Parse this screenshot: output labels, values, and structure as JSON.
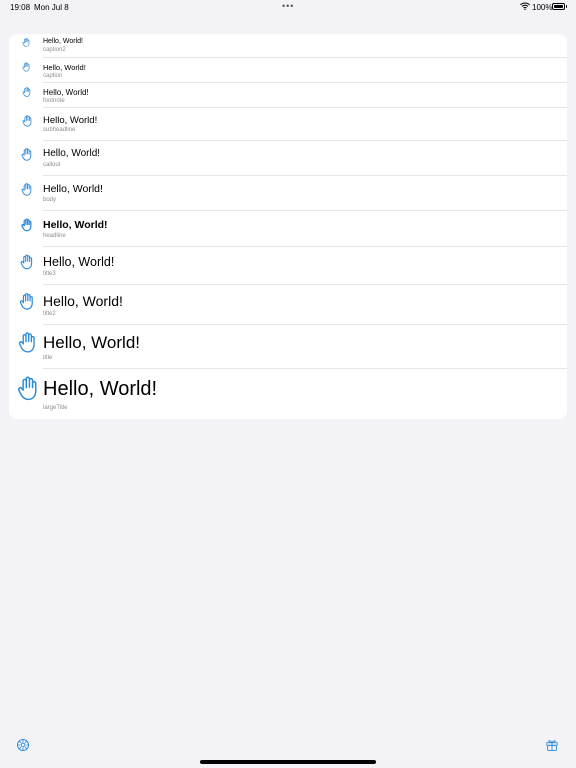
{
  "status_bar": {
    "time": "19:08",
    "date": "Mon Jul 8",
    "dots": "•••",
    "battery_pct": "100%"
  },
  "accent_color": "#2e8bd8",
  "rows": [
    {
      "icon": "hand-raised-icon",
      "title": "Hello, World!",
      "style": "caption2"
    },
    {
      "icon": "hand-raised-icon",
      "title": "Hello, World!",
      "style": "caption"
    },
    {
      "icon": "hand-raised-icon",
      "title": "Hello, World!",
      "style": "footnote"
    },
    {
      "icon": "hand-raised-icon",
      "title": "Hello, World!",
      "style": "subheadline"
    },
    {
      "icon": "hand-raised-icon",
      "title": "Hello, World!",
      "style": "callout"
    },
    {
      "icon": "hand-raised-icon",
      "title": "Hello, World!",
      "style": "body"
    },
    {
      "icon": "hand-raised-icon",
      "title": "Hello, World!",
      "style": "headline"
    },
    {
      "icon": "hand-raised-icon",
      "title": "Hello, World!",
      "style": "title3"
    },
    {
      "icon": "hand-raised-icon",
      "title": "Hello, World!",
      "style": "title2"
    },
    {
      "icon": "hand-raised-icon",
      "title": "Hello, World!",
      "style": "title"
    },
    {
      "icon": "hand-raised-icon",
      "title": "Hello, World!",
      "style": "largeTitle"
    }
  ],
  "bottom_bar": {
    "left_icon": "gear-icon",
    "right_icon": "gift-icon"
  }
}
